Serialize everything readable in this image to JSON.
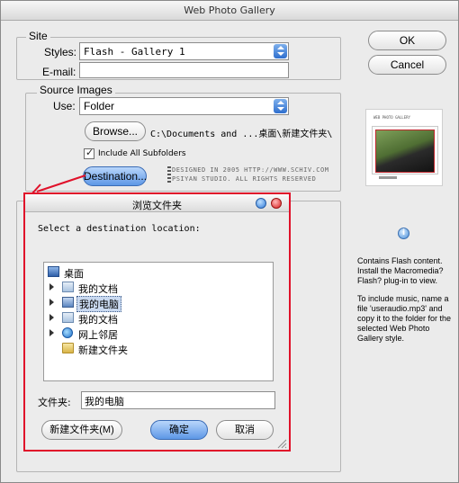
{
  "window": {
    "title": "Web Photo Gallery"
  },
  "site": {
    "legend": "Site",
    "styles_label": "Styles:",
    "styles_value": "Flash - Gallery 1",
    "email_label": "E-mail:",
    "email_value": ""
  },
  "source": {
    "legend": "Source Images",
    "use_label": "Use:",
    "use_value": "Folder",
    "browse_label": "Browse...",
    "path": "C:\\Documents and ...桌面\\新建文件夹\\",
    "include_subfolders": "Include All Subfolders",
    "destination_label": "Destination..."
  },
  "watermark": {
    "line1": "DESIGNED IN 2005 HTTP://WWW.SCHIV.COM",
    "line2": "PSIYAN STUDIO. ALL RIGHTS RESERVED"
  },
  "buttons": {
    "ok": "OK",
    "cancel": "Cancel"
  },
  "preview": {
    "thumb_title": "WEB PHOTO GALLERY",
    "info1": "Contains Flash content. Install the Macromedia? Flash? plug-in to view.",
    "info2": "To include music, name a file 'useraudio.mp3' and copy it to the folder for the selected Web Photo Gallery style."
  },
  "dialog": {
    "title": "浏览文件夹",
    "prompt": "Select a destination location:",
    "tree": [
      {
        "label": "桌面",
        "icon": "desktop-icon"
      },
      {
        "label": "我的文档",
        "icon": "documents-folder-icon"
      },
      {
        "label": "我的电脑",
        "icon": "computer-icon"
      },
      {
        "label": "我的文档",
        "icon": "documents-folder-icon"
      },
      {
        "label": "网上邻居",
        "icon": "network-icon"
      },
      {
        "label": "新建文件夹",
        "icon": "folder-icon"
      }
    ],
    "folder_label": "文件夹:",
    "folder_value": "我的电脑",
    "new_folder": "新建文件夹(M)",
    "ok": "确定",
    "cancel": "取消"
  },
  "colors": {
    "highlight_red": "#e0112a",
    "accent_blue": "#3a78d6"
  }
}
